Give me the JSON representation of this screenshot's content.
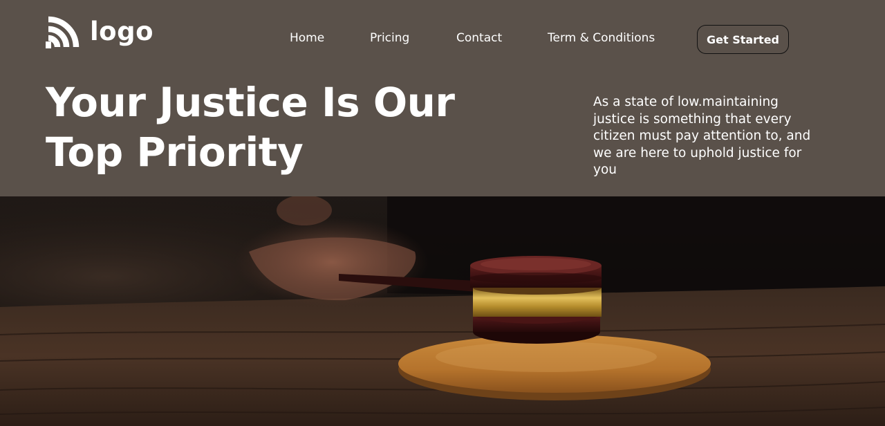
{
  "brand": {
    "logo_text": "logo",
    "logo_icon": "wifi-arcs-icon"
  },
  "nav": {
    "items": [
      {
        "label": "Home"
      },
      {
        "label": "Pricing"
      },
      {
        "label": "Contact"
      },
      {
        "label": "Term & Conditions"
      }
    ],
    "cta_label": "Get Started"
  },
  "hero": {
    "headline_line1": "Your Justice Is Our",
    "headline_line2": "Top Priority",
    "tagline": "As a state of low.maintaining justice is something that every citizen must pay attention to, and we are here to uphold justice for you"
  },
  "theme": {
    "band_color": "#5a514a",
    "text_color": "#ffffff",
    "button_border_color": "#111111"
  },
  "photo": {
    "subject": "gavel-on-sound-block-image"
  }
}
